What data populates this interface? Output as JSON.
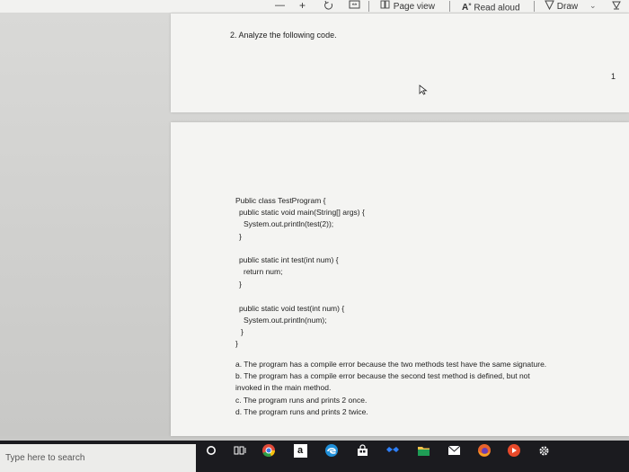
{
  "toolbar": {
    "minus": "—",
    "plus": "+",
    "page_view": "Page view",
    "read_aloud": "Read aloud",
    "draw": "Draw"
  },
  "document": {
    "question_title": "2. Analyze the following code.",
    "page_number": "1",
    "code_lines": [
      "Public class TestProgram {",
      "public static void main(String[] args) {",
      "System.out.println(test(2));",
      "}",
      "public static int test(int num) {",
      "return num;",
      "}",
      "public static void test(int num) {",
      "System.out.println(num);",
      "}",
      "}"
    ],
    "options": [
      "a. The program has a compile error because the two methods test have the same signature.",
      "b. The program has a compile error because the second test method is defined, but not",
      "invoked in the main method.",
      "c. The program runs and prints 2 once.",
      "d. The program runs and prints 2 twice."
    ]
  },
  "taskbar": {
    "search_placeholder": "Type here to search",
    "amazon_glyph": "a"
  },
  "colors": {
    "taskbar": "#1b1b1f",
    "page": "#f4f4f2",
    "workspace": "#d5d5d3"
  }
}
